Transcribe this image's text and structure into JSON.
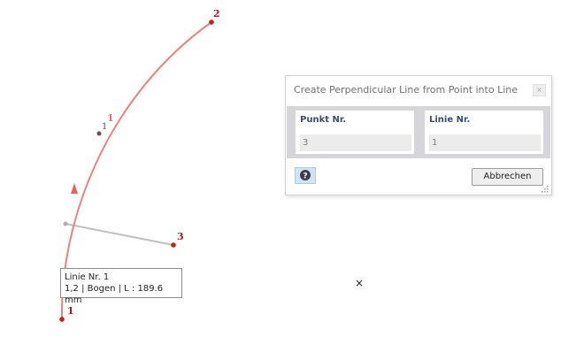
{
  "nodes": {
    "start": "1",
    "end": "2",
    "point": "3",
    "line_mid": "1",
    "line_mid_small": "1"
  },
  "tooltip": {
    "line1": "Linie Nr. 1",
    "line2": "1,2 | Bogen | L : 189.6 mm"
  },
  "dialog": {
    "title": "Create Perpendicular Line from Point into Line",
    "close_glyph": "×",
    "fields": [
      {
        "label": "Punkt Nr.",
        "value": "3"
      },
      {
        "label": "Linie Nr.",
        "value": "1"
      }
    ],
    "cancel_label": "Abbrechen"
  },
  "cursor_glyph": "×",
  "colors": {
    "arc": "#f08080",
    "node": "#d01818",
    "perpendicular": "#c0c0c0",
    "field_label": "#3b4a78"
  }
}
